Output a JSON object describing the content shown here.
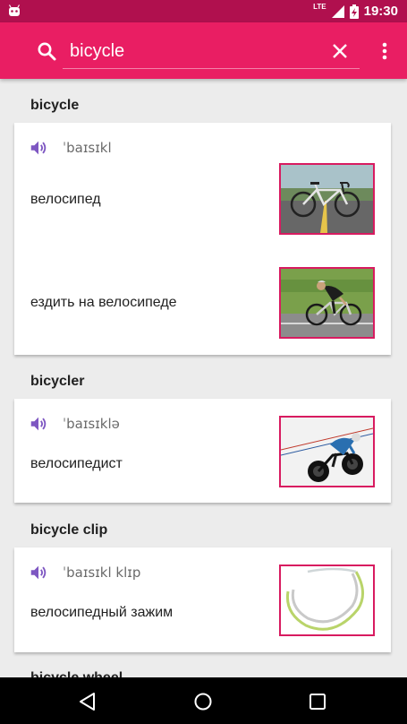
{
  "status_bar": {
    "time": "19:30",
    "network_label": "LTE",
    "icons": [
      "android-icon",
      "signal-icon",
      "battery-charging-icon"
    ]
  },
  "toolbar": {
    "search_value": "bicycle",
    "icons": [
      "search-icon",
      "clear-icon",
      "more-vert-icon"
    ],
    "color": "#e91e63",
    "status_color": "#b0104e"
  },
  "results": [
    {
      "headword": "bicycle",
      "pronunciation": "ˈbaɪsɪkl",
      "senses": [
        {
          "translation": "велосипед",
          "image": "road-bicycle-image"
        },
        {
          "translation": "ездить на велосипеде",
          "image": "cyclist-riding-image"
        }
      ]
    },
    {
      "headword": "bicycler",
      "pronunciation": "ˈbaɪsɪklə",
      "senses": [
        {
          "translation": "велосипедист",
          "image": "track-cyclist-image"
        }
      ]
    },
    {
      "headword": "bicycle clip",
      "pronunciation": "ˈbaɪsɪkl klɪp",
      "senses": [
        {
          "translation": "велосипедный зажим",
          "image": "bicycle-clips-image"
        }
      ]
    },
    {
      "headword": "bicycle wheel"
    }
  ],
  "accent_colors": {
    "speaker": "#7e57c2",
    "image_border": "#d81b60"
  },
  "nav_bar": {
    "icons": [
      "back-icon",
      "home-icon",
      "recents-icon"
    ]
  }
}
